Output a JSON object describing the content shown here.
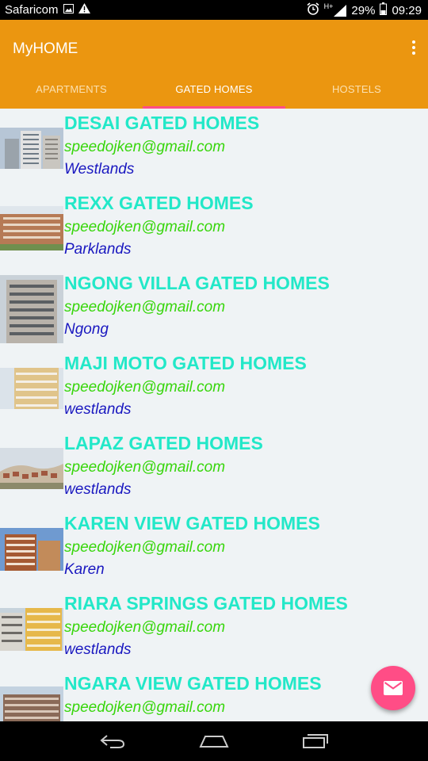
{
  "status_bar": {
    "carrier": "Safaricom",
    "network": "H+",
    "battery": "29%",
    "time": "09:29"
  },
  "app": {
    "title": "MyHOME"
  },
  "tabs": [
    {
      "label": "APARTMENTS",
      "active": false
    },
    {
      "label": "GATED HOMES",
      "active": true
    },
    {
      "label": "HOSTELS",
      "active": false
    }
  ],
  "listings": [
    {
      "name": "DESAI GATED HOMES",
      "email": "speedojken@gmail.com",
      "location": "Westlands"
    },
    {
      "name": "REXX GATED HOMES",
      "email": "speedojken@gmail.com",
      "location": "Parklands"
    },
    {
      "name": "NGONG VILLA GATED HOMES",
      "email": "speedojken@gmail.com",
      "location": "Ngong"
    },
    {
      "name": "MAJI MOTO GATED HOMES",
      "email": "speedojken@gmail.com",
      "location": "westlands"
    },
    {
      "name": "LAPAZ GATED HOMES",
      "email": "speedojken@gmail.com",
      "location": "westlands"
    },
    {
      "name": "KAREN VIEW GATED HOMES",
      "email": "speedojken@gmail.com",
      "location": "Karen"
    },
    {
      "name": "RIARA SPRINGS GATED HOMES",
      "email": "speedojken@gmail.com",
      "location": "westlands"
    },
    {
      "name": "NGARA VIEW GATED HOMES",
      "email": "speedojken@gmail.com",
      "location": ""
    }
  ],
  "colors": {
    "app_bar": "#eb9610",
    "tab_indicator": "#ff4d86",
    "name_text": "#22e8c8",
    "email_text": "#37d60b",
    "location_text": "#1a18c0",
    "fab": "#ff4d86"
  },
  "icons": {
    "fab": "envelope-icon",
    "overflow": "more-vert-icon",
    "nav": [
      "back-icon",
      "home-icon",
      "recents-icon"
    ]
  }
}
